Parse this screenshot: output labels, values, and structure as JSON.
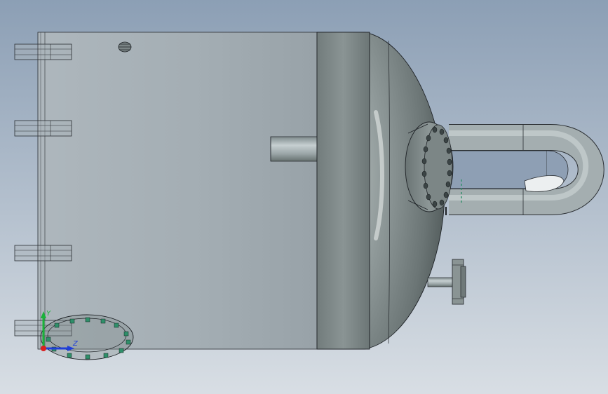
{
  "viewport": {
    "background_top": "#8ea0b6",
    "background_bottom": "#d7dde3"
  },
  "colors": {
    "shell_light": "#b3bcc1",
    "shell_mid": "#9aa4ab",
    "shell_dark": "#6f7a80",
    "flange": "#7d8787",
    "outline": "#202428",
    "bolt": "#2f8f6a",
    "axis_x": "#1f3fd9",
    "axis_y": "#19b33a",
    "axis_origin": "#d92020"
  },
  "triad": {
    "x_label": "Z",
    "y_label": "Y",
    "icon": "coordinate-triad-icon"
  }
}
